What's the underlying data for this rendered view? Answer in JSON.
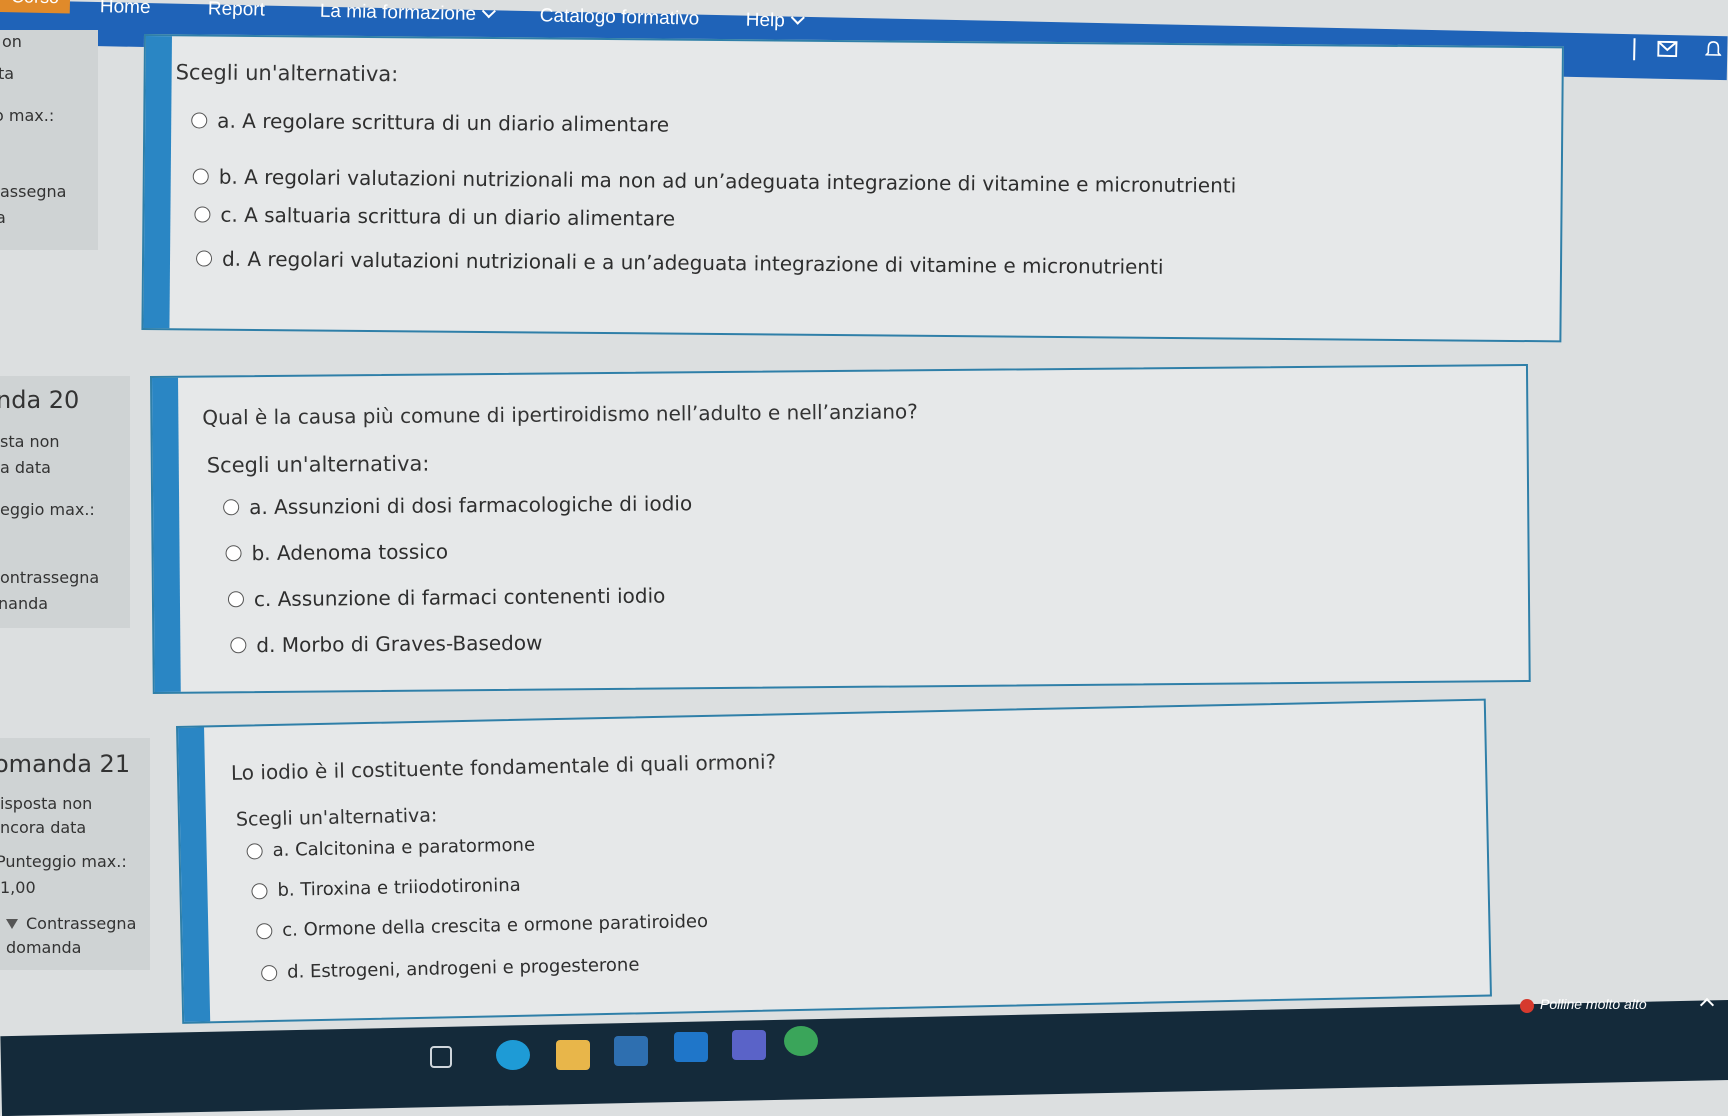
{
  "nav": {
    "brand": "Corso",
    "items": [
      {
        "label": "Home"
      },
      {
        "label": "Report"
      },
      {
        "label": "La mia formazione",
        "has_dropdown": true
      },
      {
        "label": "Catalogo formativo"
      },
      {
        "label": "Help",
        "has_dropdown": true
      }
    ],
    "icons": [
      "messages-icon",
      "bell-icon"
    ]
  },
  "colors": {
    "navbar": "#1f63b8",
    "accent_stripe": "#2a86c4",
    "brand_tab": "#e08a2a",
    "card_border": "#2f7fa8"
  },
  "sidebar_prev": {
    "lines": [
      "on",
      "ta",
      "o max.:",
      "assegna",
      "a"
    ]
  },
  "questions": [
    {
      "choose_label": "Scegli un'alternativa:",
      "options": [
        "a. A regolare scrittura di un diario alimentare",
        "b. A regolari valutazioni nutrizionali ma non ad un’adeguata integrazione di vitamine e micronutrienti",
        "c. A saltuaria scrittura di un diario alimentare",
        "d. A regolari valutazioni nutrizionali e a un’adeguata integrazione di vitamine e micronutrienti"
      ]
    },
    {
      "sidebar": {
        "title": "nda 20",
        "status_1": "sta non",
        "status_2": "a data",
        "points": "eggio max.:",
        "flag_1": "ontrassegna",
        "flag_2": "nanda"
      },
      "text": "Qual è la causa più comune di ipertiroidismo nell’adulto e nell’anziano?",
      "choose_label": "Scegli un'alternativa:",
      "options": [
        "a. Assunzioni di dosi farmacologiche di iodio",
        "b. Adenoma tossico",
        "c. Assunzione di farmaci contenenti iodio",
        "d. Morbo di Graves-Basedow"
      ]
    },
    {
      "sidebar": {
        "title": "omanda 21",
        "status_1": "isposta non",
        "status_2": "ncora data",
        "points": "Punteggio max.:",
        "points_value": "1,00",
        "flag_1": "Contrassegna",
        "flag_2": "domanda"
      },
      "text": "Lo iodio è il costituente fondamentale di quali ormoni?",
      "choose_label": "Scegli un'alternativa:",
      "options": [
        "a. Calcitonina e paratormone",
        "b. Tiroxina e triiodotironina",
        "c. Ormone della crescita e ormone paratiroideo",
        "d. Estrogeni, androgeni e progesterone"
      ]
    }
  ],
  "taskbar": {
    "weather": "Polline molto alto",
    "apps": [
      "task-view-icon",
      "edge-browser-icon",
      "file-explorer-icon",
      "store-icon",
      "outlook-icon",
      "teams-icon",
      "chrome-icon"
    ]
  }
}
